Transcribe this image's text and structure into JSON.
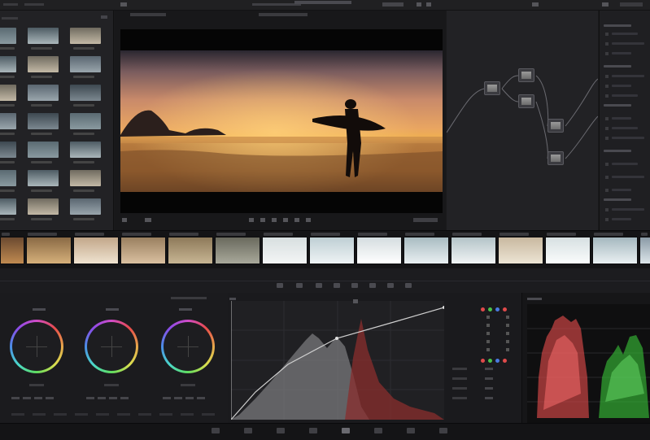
{
  "app": {
    "title": "",
    "accent": "#d05a2c"
  },
  "viewer": {
    "timecode": ""
  },
  "colors": {
    "viewer_sky": "#c98a6a",
    "viewer_sun": "#f0b050",
    "wheel_ring": "rainbow",
    "scope_red": "#e05050",
    "scope_green": "#40d040",
    "curve_line": "#cfcfcf"
  },
  "icons": [
    "play-icon",
    "stop-icon",
    "loop-icon",
    "clip-icon",
    "node-icon"
  ]
}
